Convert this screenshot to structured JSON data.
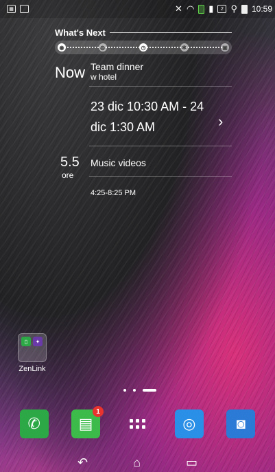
{
  "status_bar": {
    "left_icons": [
      "calendar-icon",
      "image-icon"
    ],
    "right_icons": [
      "mute-icon",
      "wifi-icon",
      "battery-saver-icon",
      "signal-icon",
      "sim-2-icon",
      "location-icon",
      "battery-icon"
    ],
    "clock": "10:59",
    "sim_label": "2"
  },
  "widget": {
    "header": "What's Next",
    "now_label": "Now",
    "event_title": "Team dinner",
    "event_location": "w hotel",
    "event_date": "23 dic 10:30 AM - 24 dic 1:30 AM",
    "chevron": "›",
    "next_duration": "5.5",
    "next_unit": "ore",
    "next_title": "Music videos",
    "next_time": "4:25-8:25 PM"
  },
  "folder": {
    "label": "ZenLink"
  },
  "nav": {
    "back": "↶",
    "home": "⌂",
    "recent": "▭"
  },
  "dock": {
    "messages_badge": "1"
  },
  "colors": {
    "phone": "#2da846",
    "messages": "#3cbb4a",
    "browser": "#2a8fe6",
    "camera": "#2a7ad6",
    "badge": "#e8332e"
  }
}
